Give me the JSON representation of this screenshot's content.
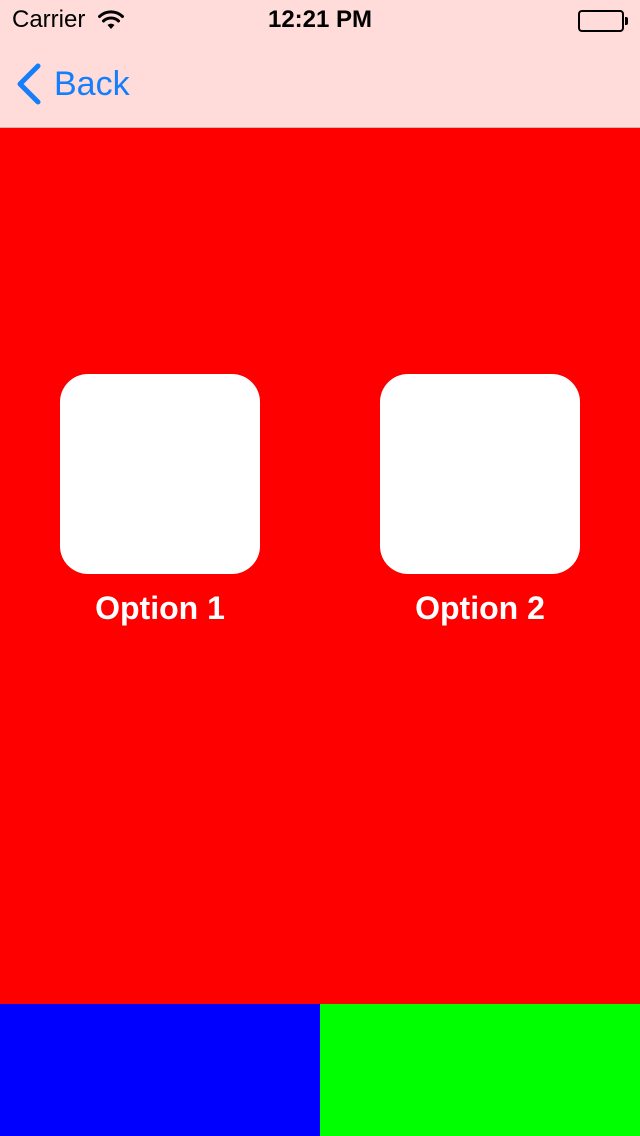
{
  "status_bar": {
    "carrier": "Carrier",
    "time": "12:21 PM",
    "wifi_icon": "wifi-icon",
    "battery_icon": "battery-icon"
  },
  "nav": {
    "back_label": "Back",
    "back_icon": "chevron-left-icon"
  },
  "options": [
    {
      "label": "Option 1"
    },
    {
      "label": "Option 2"
    }
  ],
  "colors": {
    "bar_background": "#ffdbd9",
    "accent": "#157efb",
    "main_background": "#ff0000",
    "bottom_left": "#0000ff",
    "bottom_right": "#00ff00"
  }
}
